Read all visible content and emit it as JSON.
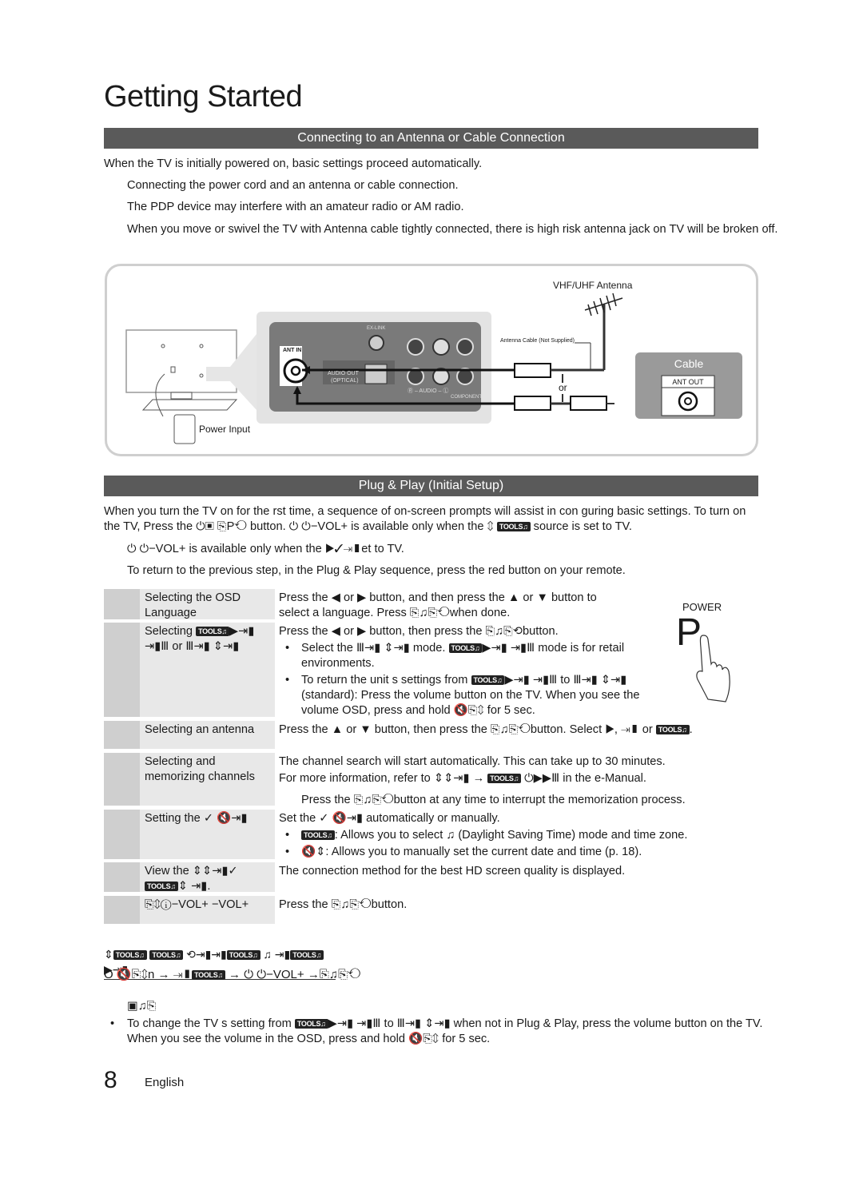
{
  "page_title": "Getting Started",
  "section1": {
    "header": "Connecting to an Antenna or Cable Connection",
    "intro": "When the TV is initially powered on, basic settings proceed automatically.",
    "notes": [
      "Connecting the power cord and an antenna or cable connection.",
      "The PDP device may interfere with an amateur radio or AM radio.",
      "When you move or swivel the TV with Antenna cable tightly connected, there is high risk antenna jack on TV will be broken off."
    ],
    "diagram": {
      "antenna_label": "VHF/UHF Antenna",
      "cable_label": "Antenna Cable (Not Supplied)",
      "ant_in": "ANT IN",
      "ex_link": "EX-LINK",
      "audio_out": "AUDIO OUT",
      "optical": "(OPTICAL)",
      "audio": "Ⓡ – AUDIO – Ⓛ",
      "component": "COMPONENT",
      "or": "or",
      "cable_box_title": "Cable",
      "ant_out": "ANT OUT",
      "power_input": "Power Input"
    }
  },
  "section2": {
    "header": "Plug & Play (Initial Setup)",
    "intro_line1": "When you turn the TV on for the  rst time, a sequence of on-screen prompts will assist in con guring basic settings. To turn on",
    "intro_line2": "the TV, Press the ⏻▣ ⎘P⟲ button. ⏻  ⏻−VOL+ is available only when the ⇕ TOOLS♫ source is set to TV.",
    "note1": "⏻  ⏻−VOL+ is available only when the ▶✓⇥▮et to TV.",
    "note2": "To return to the previous step, in the Plug & Play sequence, press the red button on your remote.",
    "power_label": "POWER",
    "power_letter": "P",
    "steps": [
      {
        "label": "Selecting the OSD Language",
        "lines": [
          "Press the ◀ or ▶ button, and then press the ▲ or ▼ button to",
          "select a language. Press ⎘♫⎘⟲when done."
        ],
        "bullets": []
      },
      {
        "label": "Selecting TOOLS♫▶⇥▮ ⇥▮Ⅲ or Ⅲ⇥▮ ⇕⇥▮",
        "lines": [
          "Press the ◀ or ▶ button, then press the ⎘♫⎘⟲button."
        ],
        "bullets": [
          "Select the Ⅲ⇥▮ ⇕⇥▮ mode. TOOLS♫▶⇥▮ ⇥▮Ⅲ mode is for retail environments.",
          "To return the unit s settings from TOOLS♫▶⇥▮ ⇥▮Ⅲ to Ⅲ⇥▮ ⇕⇥▮ (standard): Press the volume button on the TV. When you see the volume OSD, press and hold 🔇⎘⇕ for 5 sec."
        ]
      },
      {
        "label": "Selecting an antenna",
        "lines": [
          "Press the ▲ or ▼ button, then press the ⎘♫⎘⟲button. Select ▶, ⇥▮ or TOOLS♫."
        ],
        "bullets": []
      },
      {
        "label": "Selecting and memorizing channels",
        "lines": [
          "The channel search will start automatically. This can take up to 30 minutes.",
          "For more information, refer to ⇕⇕⇥▮ → TOOLS♫ ⏻▶▶Ⅲ in the e-Manual."
        ],
        "bullets": [],
        "note": "Press the ⎘♫⎘⟲button at any time to interrupt the memorization process."
      },
      {
        "label": "Setting the ✓ 🔇⇥▮",
        "lines": [
          "Set the ✓ 🔇⇥▮ automatically or manually."
        ],
        "bullets": [
          "TOOLS♫: Allows you to select ♫ (Daylight Saving Time) mode and time zone.",
          "🔇⇕: Allows you to manually set the current date and time (p. 18)."
        ]
      },
      {
        "label": "View the ⇕⇕⇥▮✓ TOOLS♫⇕ ⇥▮.",
        "lines": [
          "The connection method for the best HD screen quality is displayed."
        ],
        "bullets": []
      },
      {
        "label": "⎘⇕ⓘ−VOL+ −VOL+",
        "lines": [
          "Press the ⎘♫⎘⟲button."
        ],
        "bullets": []
      }
    ],
    "reset_heading": "⇕TOOLS♫ TOOLS♫ ⟲⇥▮⇥▮TOOLS♫ ♫ ⇥▮TOOLS♫▶⇥▮",
    "reset_line": "O   🔇⎘⇕n  → ⇥▮TOOLS♫ → ⏻  ⏻−VOL+ →⎘♫⎘⟲",
    "reset_sub": "▣♫⎘",
    "final_bullet_line1": "To change the TV s setting from TOOLS♫▶⇥▮ ⇥▮Ⅲ to Ⅲ⇥▮ ⇕⇥▮ when not in Plug & Play, press the volume button on the TV.",
    "final_bullet_line2": "When you see the volume in the OSD, press and hold 🔇⎘⇕ for 5 sec."
  },
  "footer": {
    "page_number": "8",
    "language": "English"
  }
}
